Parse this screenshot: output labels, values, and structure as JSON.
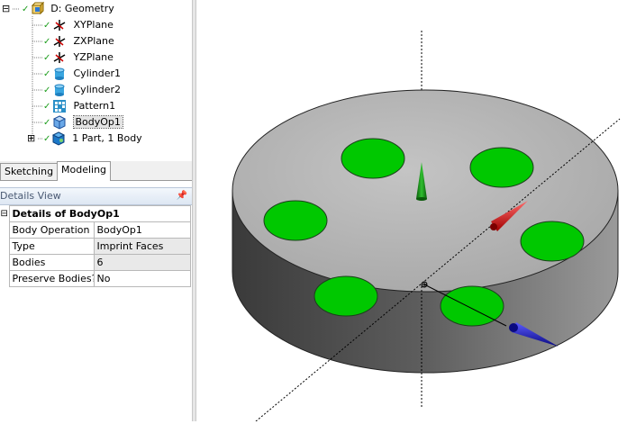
{
  "tree": {
    "root": {
      "label": "D: Geometry",
      "expander": "⊟"
    },
    "items": [
      {
        "label": "XYPlane",
        "icon": "plane-axes-icon"
      },
      {
        "label": "ZXPlane",
        "icon": "plane-axes-icon"
      },
      {
        "label": "YZPlane",
        "icon": "plane-axes-icon"
      },
      {
        "label": "Cylinder1",
        "icon": "cylinder-icon"
      },
      {
        "label": "Cylinder2",
        "icon": "cylinder-icon"
      },
      {
        "label": "Pattern1",
        "icon": "pattern-icon"
      },
      {
        "label": "BodyOp1",
        "icon": "body-operation-icon"
      },
      {
        "label": "1 Part, 1 Body",
        "icon": "part-body-icon",
        "expander": "⊞"
      }
    ]
  },
  "tabs": [
    {
      "label": "Sketching",
      "active": false
    },
    {
      "label": "Modeling",
      "active": true
    }
  ],
  "details_view": {
    "title": "Details View",
    "pin": "📌",
    "group": {
      "label": "Details of BodyOp1",
      "expander": "⊟"
    },
    "rows": [
      {
        "label": "Body Operation",
        "value": "BodyOp1"
      },
      {
        "label": "Type",
        "value": "Imprint Faces"
      },
      {
        "label": "Bodies",
        "value": "6"
      },
      {
        "label": "Preserve Bodies?",
        "value": "No"
      }
    ]
  },
  "viewport": {
    "colors": {
      "face_top": "#b5b5b5",
      "imprint": "#00c800",
      "triad_y": "#0a7a0a",
      "triad_x": "#d42020",
      "triad_z": "#1a1ab0"
    }
  }
}
